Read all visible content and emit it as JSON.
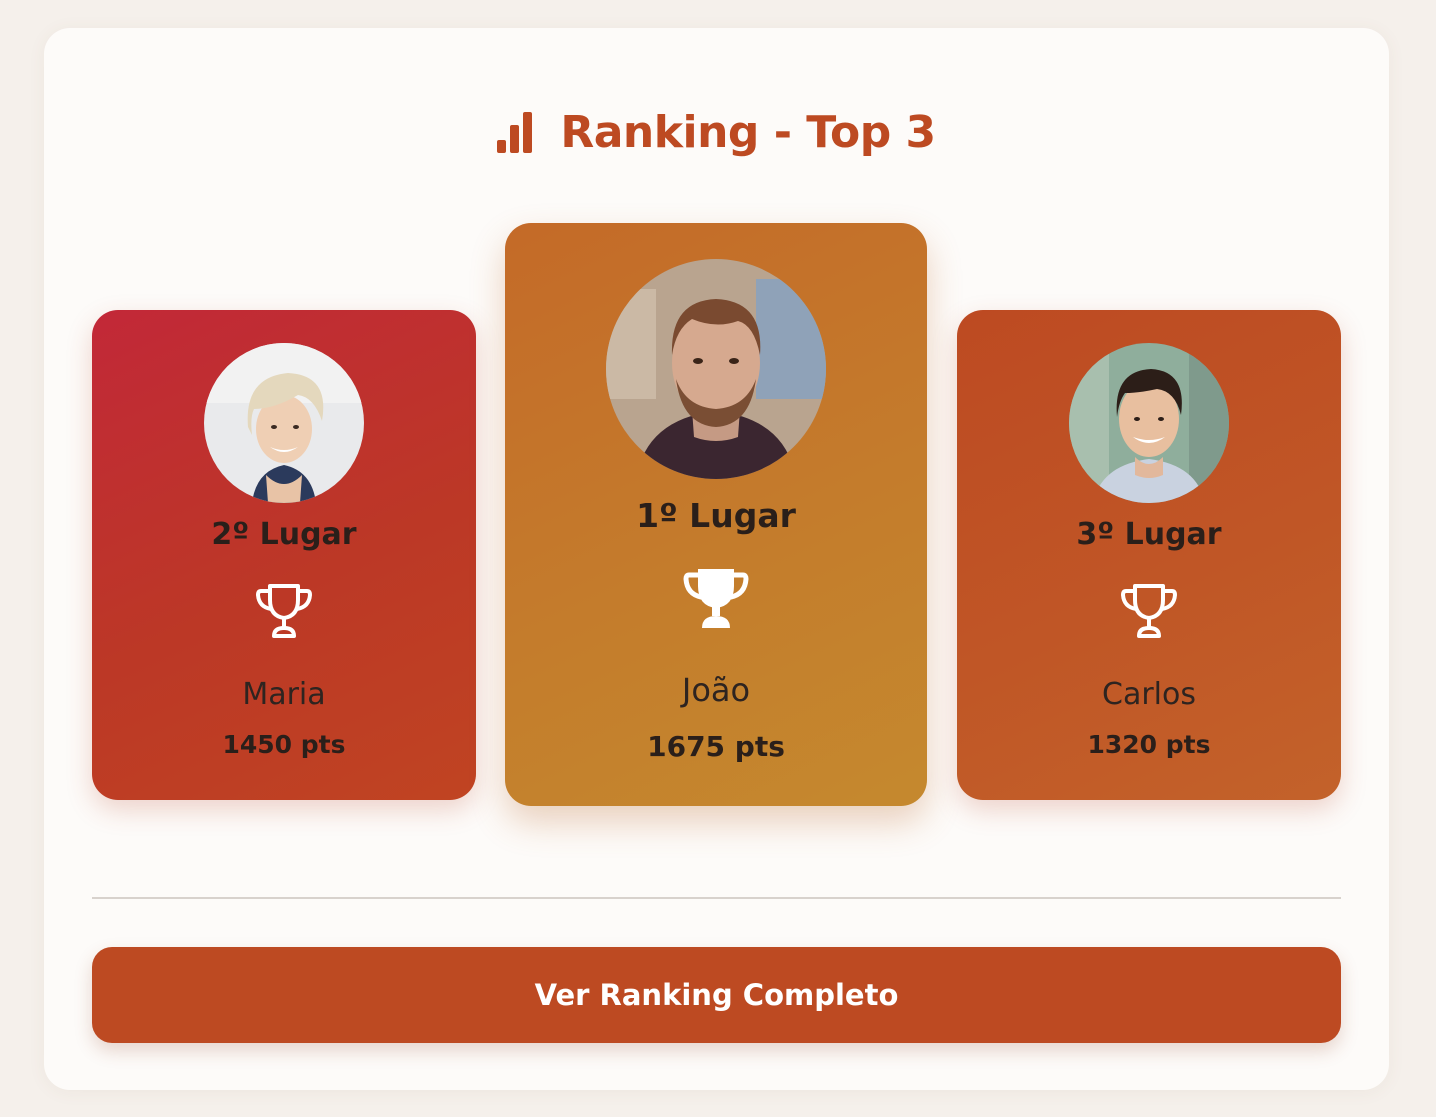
{
  "header": {
    "icon": "bar-chart-icon",
    "title": "Ranking - Top 3"
  },
  "podium": [
    {
      "position": 2,
      "place_label": "2º Lugar",
      "name": "Maria",
      "points": "1450 pts",
      "icon": "trophy-outline-icon",
      "gradient": [
        "#c22838",
        "#c04422"
      ]
    },
    {
      "position": 1,
      "place_label": "1º Lugar",
      "name": "João",
      "points": "1675 pts",
      "icon": "trophy-filled-icon",
      "gradient": [
        "#c46a28",
        "#c5892e"
      ]
    },
    {
      "position": 3,
      "place_label": "3º Lugar",
      "name": "Carlos",
      "points": "1320 pts",
      "icon": "trophy-outline-icon",
      "gradient": [
        "#bd4a22",
        "#c3622a"
      ]
    }
  ],
  "footer": {
    "button_label": "Ver Ranking Completo"
  },
  "colors": {
    "accent": "#bd4a22",
    "background": "#f5f0eb",
    "panel": "#fdfbf9"
  }
}
